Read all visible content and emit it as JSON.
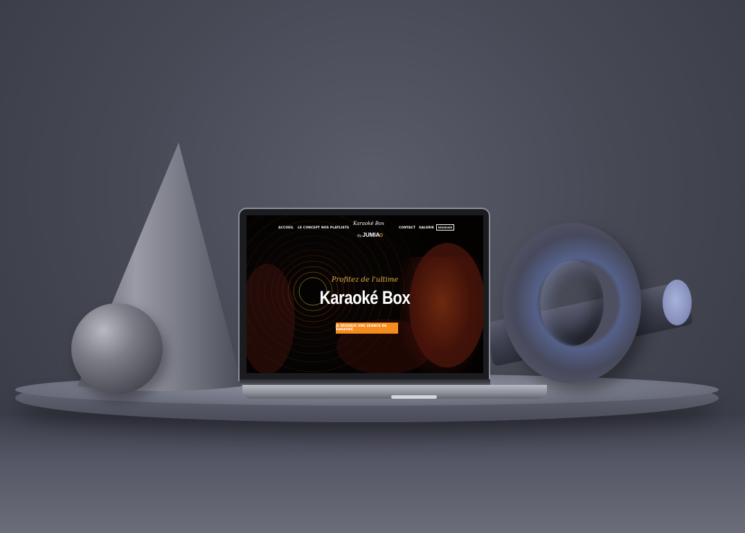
{
  "nav": {
    "items": [
      "ACCUEIL",
      "LE CONCEPT",
      "NOS PLAYLISTS",
      "CONTACT",
      "GALERIE"
    ],
    "cta_label": "RÉSERVER"
  },
  "logo": {
    "script_text": "Karaoké Box",
    "by_text": "By",
    "brand_text": "JUMIA"
  },
  "hero": {
    "subtitle": "Profitez de l'ultime",
    "title": "Karaoké Box",
    "button_label": "JE RÉSERVE UNE SÉANCE DE KARAOKÉ"
  },
  "colors": {
    "accent": "#f68b1e",
    "subtitle": "#e8b04a",
    "background": "#474955"
  }
}
